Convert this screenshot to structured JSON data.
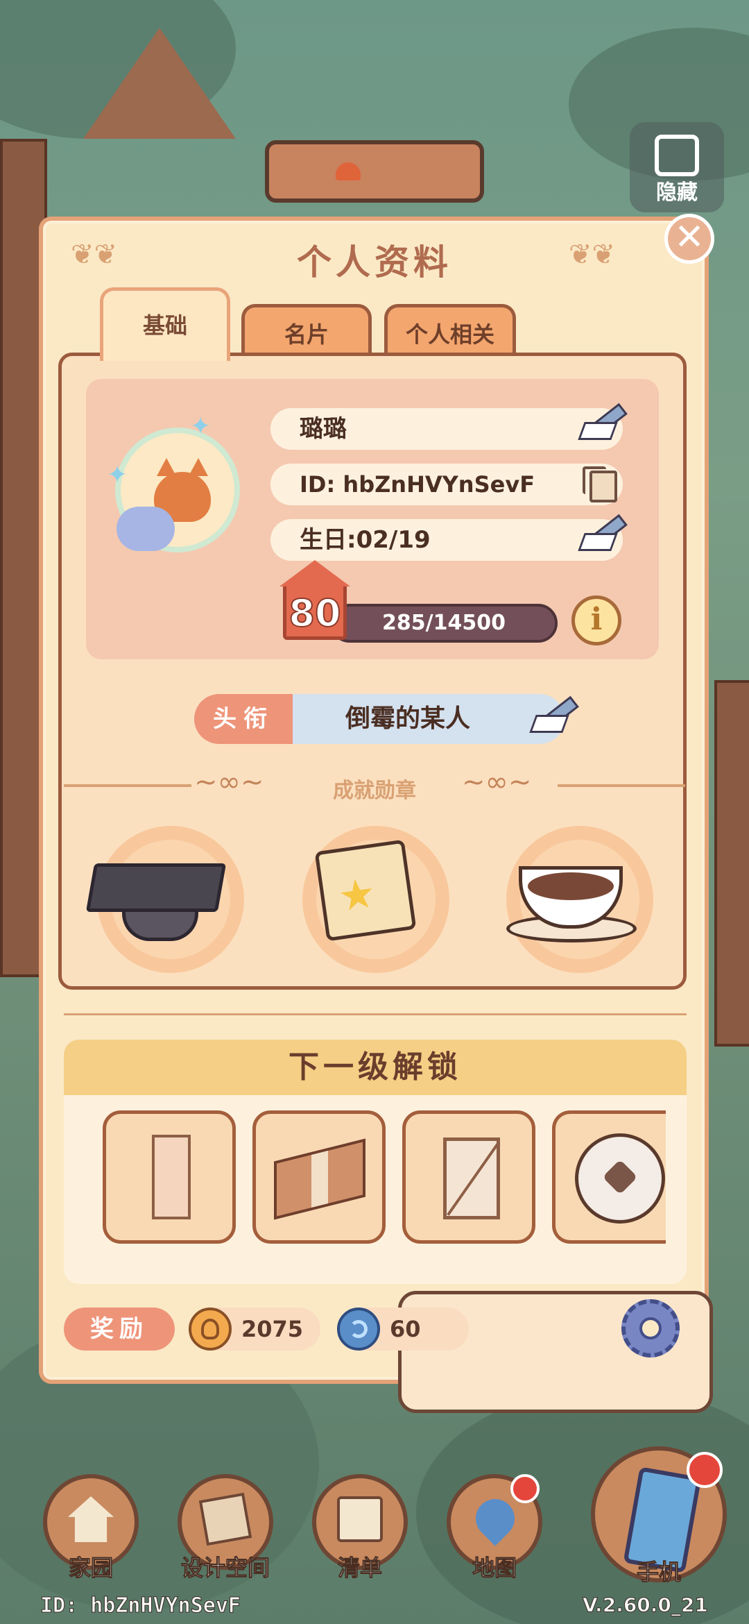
{
  "top": {
    "hide_label": "隐藏"
  },
  "panel": {
    "title": "个人资料",
    "close_symbol": "✕",
    "tabs": [
      {
        "label": "基础",
        "active": true
      },
      {
        "label": "名片",
        "active": false
      },
      {
        "label": "个人相关",
        "active": false
      }
    ]
  },
  "profile": {
    "name": "璐璐",
    "id_text": "ID: hbZnHVYnSevF",
    "birthday": "生日:02/19",
    "level": "80",
    "xp_text": "285/14500",
    "xp_fraction": 0.0197,
    "info_symbol": "i"
  },
  "title_badge": {
    "label": "头衔",
    "value": "倒霉的某人"
  },
  "achievements": {
    "label": "成就勋章",
    "medals": [
      "graduation-cap-icon",
      "star-scroll-icon",
      "latte-cup-icon"
    ]
  },
  "unlock": {
    "heading": "下一级解锁",
    "items": [
      "wood-pillar-icon",
      "cardboard-box-icon",
      "laundry-rack-icon",
      "soccer-ball-icon"
    ]
  },
  "rewards": {
    "label": "奖励",
    "coins": "2075",
    "swirl": "60"
  },
  "nav": [
    {
      "label": "家园",
      "icon": "home-icon"
    },
    {
      "label": "设计空间",
      "icon": "design-icon"
    },
    {
      "label": "清单",
      "icon": "list-icon"
    },
    {
      "label": "地图",
      "icon": "map-pin-icon"
    },
    {
      "label": "手机",
      "icon": "phone-icon"
    }
  ],
  "footer": {
    "id": "ID: hbZnHVYnSevF",
    "version": "V.2.60.0_21"
  },
  "colors": {
    "panel_bg": "#fbe9c6",
    "accent": "#ee9479",
    "border": "#9c5b3d"
  }
}
